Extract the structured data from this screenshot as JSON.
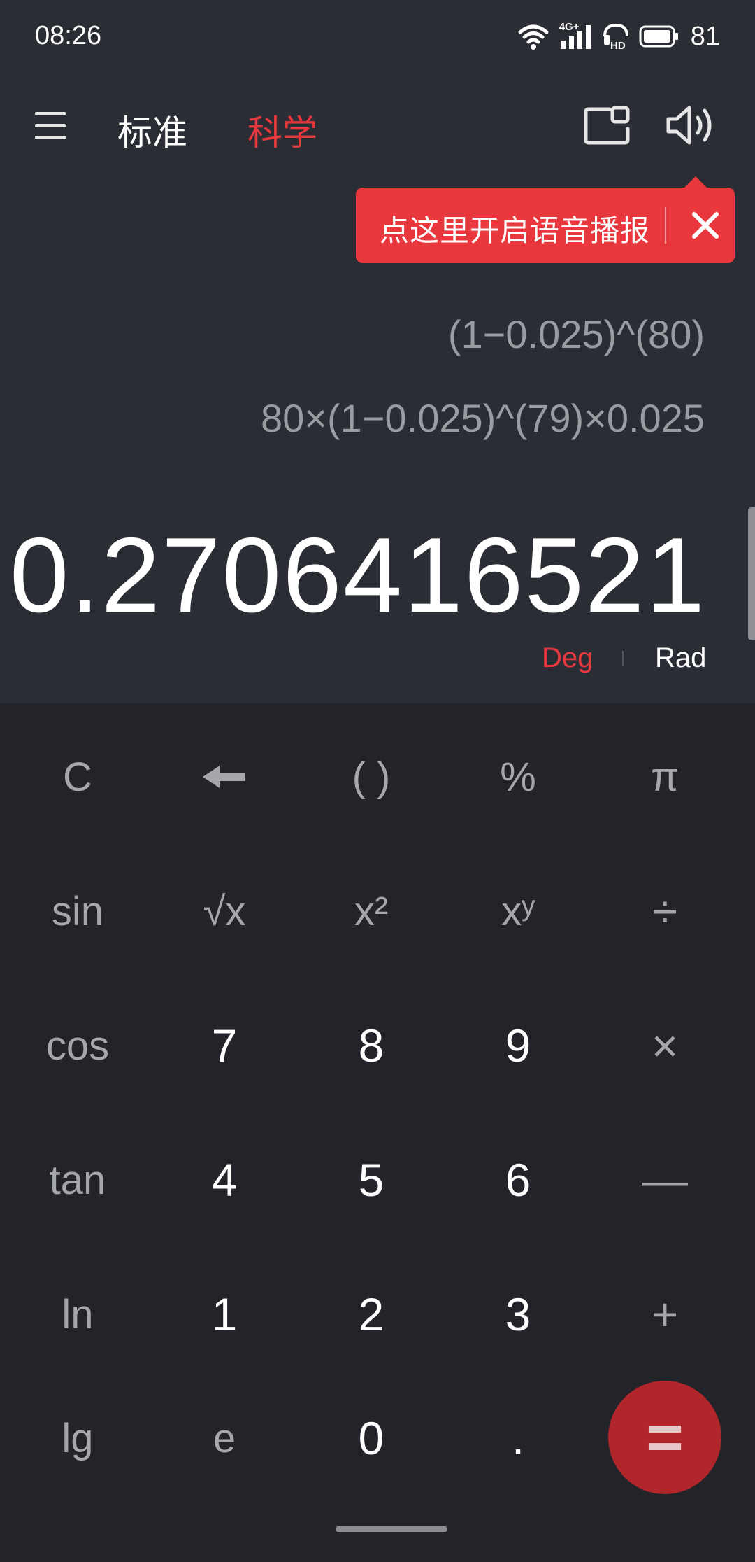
{
  "status_bar": {
    "time": "08:26",
    "network_label": "4G+",
    "battery_level": "81",
    "icons": [
      "wifi-icon",
      "signal-4g-icon",
      "hd-icon",
      "battery-icon"
    ]
  },
  "top_bar": {
    "menu_icon": "menu-icon",
    "tabs": [
      {
        "label": "标准",
        "active": false
      },
      {
        "label": "科学",
        "active": true
      }
    ],
    "float_window_icon": "floating-window-icon",
    "speaker_icon": "speaker-icon"
  },
  "voice_tip": {
    "text": "点这里开启语音播报",
    "close_icon": "close-icon"
  },
  "display": {
    "history": [
      "(1−0.025)^(80)",
      "80×(1−0.025)^(79)×0.025"
    ],
    "result": "0.2706416521",
    "angle_modes": {
      "deg": "Deg",
      "rad": "Rad",
      "active": "Deg"
    }
  },
  "keypad": {
    "rows": [
      [
        "C",
        "←",
        "( )",
        "%",
        "π"
      ],
      [
        "sin",
        "√x",
        "x²",
        "xʸ",
        "÷"
      ],
      [
        "cos",
        "7",
        "8",
        "9",
        "×"
      ],
      [
        "tan",
        "4",
        "5",
        "6",
        "—"
      ],
      [
        "ln",
        "1",
        "2",
        "3",
        "+"
      ],
      [
        "lg",
        "e",
        "0",
        "."
      ]
    ],
    "equals": "="
  },
  "colors": {
    "accent": "#e8383d",
    "background": "#2b2d34",
    "keypad_background": "#22242a",
    "equals_button": "#b0262a"
  }
}
